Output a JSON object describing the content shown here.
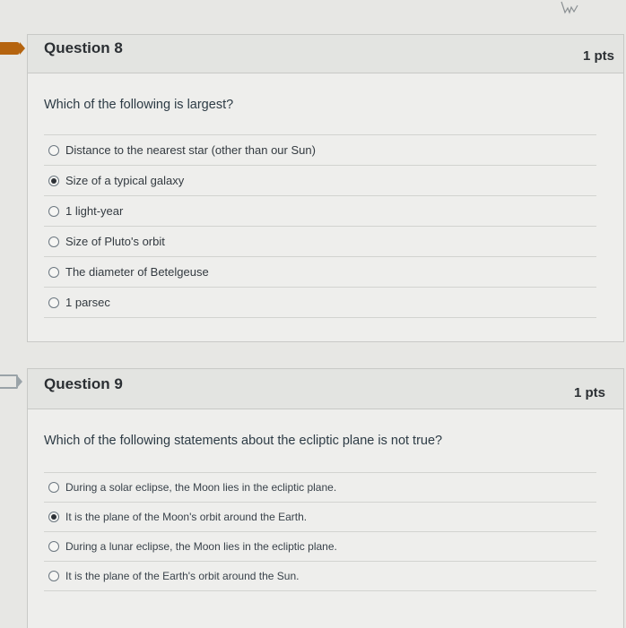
{
  "questions": [
    {
      "title": "Question 8",
      "points": "1 pts",
      "prompt": "Which of the following is largest?",
      "answers": [
        {
          "label": "Distance to the nearest star (other than our Sun)",
          "selected": false
        },
        {
          "label": "Size of a typical galaxy",
          "selected": true
        },
        {
          "label": "1 light-year",
          "selected": false
        },
        {
          "label": "Size of Pluto's orbit",
          "selected": false
        },
        {
          "label": "The diameter of Betelgeuse",
          "selected": false
        },
        {
          "label": "1 parsec",
          "selected": false
        }
      ]
    },
    {
      "title": "Question 9",
      "points": "1 pts",
      "prompt": "Which of the following statements about the ecliptic plane is not true?",
      "answers": [
        {
          "label": "During a solar eclipse, the Moon lies in the ecliptic plane.",
          "selected": false
        },
        {
          "label": "It is the plane of the Moon's orbit around the Earth.",
          "selected": true
        },
        {
          "label": "During a lunar eclipse, the Moon lies in the ecliptic plane.",
          "selected": false
        },
        {
          "label": "It is the plane of the Earth's orbit around the Sun.",
          "selected": false
        }
      ]
    }
  ],
  "icons": {
    "flagged": "flag-filled-icon",
    "unflagged": "flag-outline-icon",
    "cursor": "hand-cursor-icon"
  },
  "colors": {
    "flag": "#b5640f",
    "header_bg": "#e3e4e1",
    "body_bg": "#eeeeec"
  }
}
